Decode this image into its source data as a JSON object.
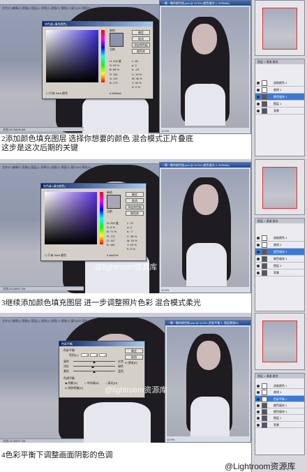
{
  "panels": [
    {
      "app_title": "文件(F) 编辑(E) 图像(I) 图层(L) 选择(S) 滤镜(T) 视图(V) 窗口(W) 帮助(H)",
      "doc_title": "一颗一颗的颜色照.psd @ 12.5% (颜色填充 1, RGB/8#)",
      "doc_status": "12.5%",
      "status_bar": "文档:15.2M/90.6M",
      "dialog_title": "拾色器 (填充颜色)",
      "dialog_buttons": [
        "确定",
        "取消",
        "添加到色板",
        "颜色库"
      ],
      "new_label": "新的",
      "current_label": "当前",
      "swatch_color": "#8d93ad",
      "values": [
        "H: 233 度",
        "S: 19 %",
        "B: 68 %",
        "R: 141",
        "G: 147",
        "B: 173"
      ],
      "lab_values": [
        "L: 60",
        "a: 2",
        "b: -15",
        "C: 15 %",
        "M: 36 %",
        "Y: 34 %",
        "K: 0 %"
      ],
      "hex_value": "8d93ad",
      "only_web_colors": "只有 Web 颜色",
      "caption": "2添加颜色填充图层 选择你想要的颜色 混合模式正片叠底",
      "caption2": "  这步是这次后期的关键",
      "layers_title": "图层 × 通道 路径",
      "layers": [
        "选取颜色 1",
        "曲线 1",
        "颜色填充 1",
        "图层 1",
        "背景"
      ]
    },
    {
      "app_title": "文件(F) 编辑(E) 图像(I) 图层(L) 选择(S) 滤镜(T) 视图(V) 窗口(W) 帮助(H)",
      "doc_title": "一颗一颗的颜色照.psd @ 12.5% (颜色填充 2, RGB/8#)",
      "doc_status": "12.5%",
      "status_bar": "文档:15.2M/97.2M",
      "dialog_title": "拾色器 (填充颜色)",
      "dialog_buttons": [
        "确定",
        "取消",
        "添加到色板",
        "颜色库"
      ],
      "new_label": "新的",
      "current_label": "当前",
      "swatch_color": "#aba6b4",
      "values": [
        "H: 253 度",
        "S: 8 %",
        "B: 71 %",
        "R: 172",
        "G: 167",
        "B: 181"
      ],
      "lab_values": [
        "L: 70",
        "a: 4",
        "b: -7",
        "C: 36 %",
        "M: 34 %",
        "Y: 23 %",
        "K: 0 %"
      ],
      "hex_value": "aba7b5",
      "only_web_colors": "只有 Web 颜色",
      "caption": "3继续添加颜色填充图层 进一步调整照片色彩 混合模式柔光",
      "watermark": "@lightroom资源库",
      "layers_title": "图层 × 通道 路径",
      "layers": [
        "选取颜色 1",
        "曲线 1",
        "颜色填充 2",
        "颜色填充 1",
        "图层 1",
        "背景"
      ]
    },
    {
      "app_title": "文件(F) 编辑(E) 图像(I) 图层(L) 选择(S) 滤镜(T) 视图(V) 窗口(W) 帮助(H)",
      "doc_title": "一颗一颗的颜色照.psd @ 12.5% (色彩平衡 1, 图层蒙版/8)",
      "doc_status": "12.5%",
      "status_bar": "文档:15.2M/97.2M",
      "dialog_title": "色彩平衡",
      "dialog_group": "色彩平衡",
      "level_label": "色阶(L):",
      "levels": [
        "-2",
        "-4",
        "-2"
      ],
      "sliders": [
        [
          "青色",
          "红色"
        ],
        [
          "洋红",
          "绿色"
        ],
        [
          "黄色",
          "蓝色"
        ]
      ],
      "tone_group": "色调平衡",
      "tones": [
        "阴影(S)",
        "中间调(D)",
        "高光(H)"
      ],
      "keep_lum": "保持明度(V)",
      "dialog_buttons": [
        "确定",
        "取消"
      ],
      "preview": "预览(P)",
      "caption": "4色彩平衡下调整画面阴影的色调",
      "watermark": "@lightroom资源库",
      "layers_title": "图层 × 通道 路径",
      "layers": [
        "选取颜色 1",
        "曲线 1",
        "色彩平衡 1",
        "颜色填充 2",
        "颜色填充 1",
        "图层 1",
        "背景"
      ]
    }
  ],
  "footer_watermark": "@Lightroom资源库"
}
